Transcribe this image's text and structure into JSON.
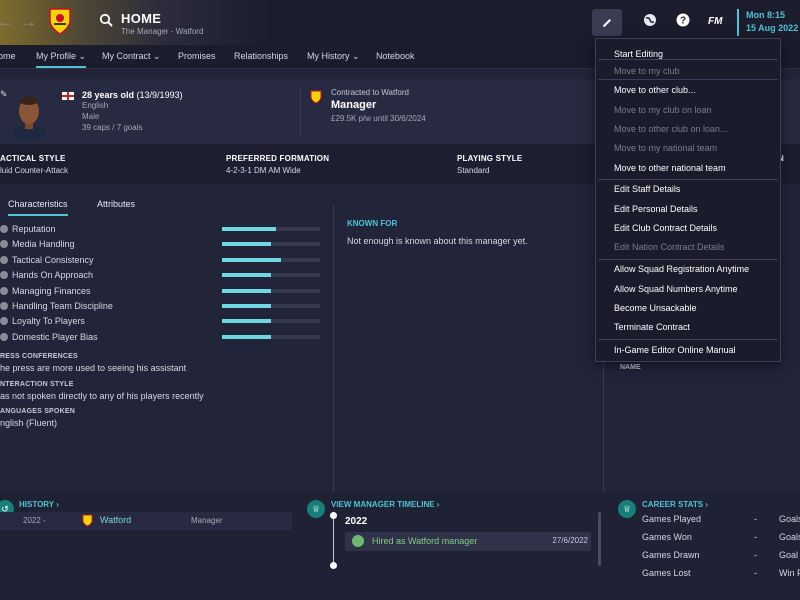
{
  "header": {
    "title": "HOME",
    "subtitle": "The Manager - Watford",
    "fm_logo": "FM",
    "time": "Mon 8:15",
    "date": "15 Aug 2022"
  },
  "nav": {
    "items": [
      {
        "label": "ome"
      },
      {
        "label": "My Profile"
      },
      {
        "label": "My Contract"
      },
      {
        "label": "Promises"
      },
      {
        "label": "Relationships"
      },
      {
        "label": "My History"
      },
      {
        "label": "Notebook"
      }
    ]
  },
  "profile": {
    "age": "28 years old",
    "dob": "(13/9/1993)",
    "nationality": "English",
    "gender": "Male",
    "caps": "39 caps / 7 goals",
    "contract_label": "Contracted to Watford",
    "role": "Manager",
    "wage": "£29.5K p/w until 30/6/2024"
  },
  "tactics": {
    "style_h": "ACTICAL STYLE",
    "style_v": "luid Counter-Attack",
    "formation_h": "PREFERRED FORMATION",
    "formation_v": "4-2-3-1 DM AM Wide",
    "playing_h": "PLAYING STYLE",
    "playing_v": "Standard",
    "cut_h": "N"
  },
  "tabs": [
    {
      "label": "Characteristics"
    },
    {
      "label": "Attributes"
    }
  ],
  "characteristics": [
    {
      "label": "Reputation",
      "value": 0.55
    },
    {
      "label": "Media Handling",
      "value": 0.5
    },
    {
      "label": "Tactical Consistency",
      "value": 0.6
    },
    {
      "label": "Hands On Approach",
      "value": 0.5
    },
    {
      "label": "Managing Finances",
      "value": 0.5
    },
    {
      "label": "Handling Team Discipline",
      "value": 0.5
    },
    {
      "label": "Loyalty To Players",
      "value": 0.5
    },
    {
      "label": "Domestic Player Bias",
      "value": 0.5
    }
  ],
  "sections": {
    "press_h": "RESS CONFERENCES",
    "press_v": "he press are more used to seeing his assistant",
    "interaction_h": "NTERACTION STYLE",
    "interaction_v": "as not spoken directly to any of his players recently",
    "languages_h": "ANGUAGES SPOKEN",
    "languages_v": "nglish (Fluent)"
  },
  "known_for": {
    "title": "KNOWN FOR",
    "text": "Not enough is known about this manager yet."
  },
  "right_panel": {
    "name_col": "NAME"
  },
  "history": {
    "title": "HISTORY ›",
    "year": "2022 -",
    "club": "Watford",
    "role": "Manager"
  },
  "timeline": {
    "title": "VIEW MANAGER TIMELINE ›",
    "year": "2022",
    "event": "Hired as Watford manager",
    "event_date": "27/6/2022"
  },
  "career_stats": {
    "title": "CAREER STATS ›",
    "rows": [
      {
        "label": "Games Played",
        "value": "-",
        "right": "Goals"
      },
      {
        "label": "Games Won",
        "value": "-",
        "right": "Goals"
      },
      {
        "label": "Games Drawn",
        "value": "-",
        "right": "Goal"
      },
      {
        "label": "Games Lost",
        "value": "-",
        "right": "Win P"
      }
    ]
  },
  "dropdown": {
    "items": [
      {
        "label": "Start Editing",
        "enabled": true
      },
      {
        "label": "Move to my club",
        "enabled": false
      },
      {
        "label": "Move to other club...",
        "enabled": true
      },
      {
        "label": "Move to my club on loan",
        "enabled": false
      },
      {
        "label": "Move to other club on loan...",
        "enabled": false
      },
      {
        "label": "Move to my national team",
        "enabled": false
      },
      {
        "label": "Move to other national team",
        "enabled": true
      },
      {
        "label": "Edit Staff Details",
        "enabled": true
      },
      {
        "label": "Edit Personal Details",
        "enabled": true
      },
      {
        "label": "Edit Club Contract Details",
        "enabled": true
      },
      {
        "label": "Edit Nation Contract Details",
        "enabled": false
      },
      {
        "label": "Allow Squad Registration Anytime",
        "enabled": true
      },
      {
        "label": "Allow Squad Numbers Anytime",
        "enabled": true
      },
      {
        "label": "Become Unsackable",
        "enabled": true
      },
      {
        "label": "Terminate Contract",
        "enabled": true
      },
      {
        "label": "In-Game Editor Online Manual",
        "enabled": true
      }
    ]
  },
  "colors": {
    "accent": "#4fc3d8",
    "bar": "#6fd6e4",
    "background": "#22243a",
    "teal_icon": "#177e7a"
  }
}
